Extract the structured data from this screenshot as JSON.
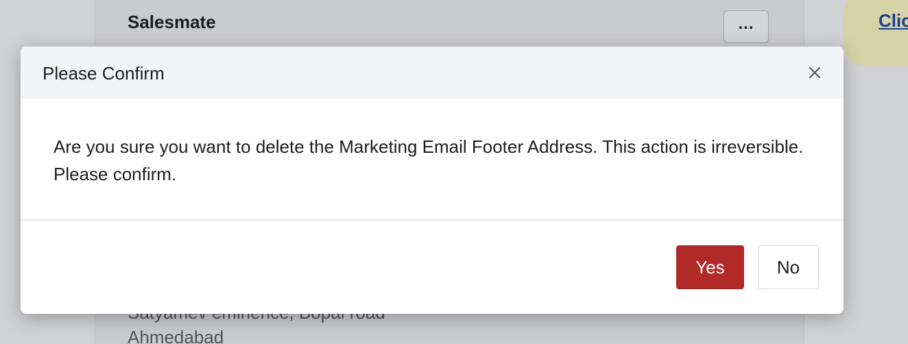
{
  "background": {
    "card_title": "Salesmate",
    "more_label": "...",
    "link_text": "Clic",
    "address_lines": [
      "Satyamev eminence, Bopal road",
      "Ahmedabad"
    ]
  },
  "modal": {
    "title": "Please Confirm",
    "close_symbol": "×",
    "message": "Are you sure you want to delete the Marketing Email Footer Address. This action is irreversible. Please confirm.",
    "yes_label": "Yes",
    "no_label": "No"
  },
  "colors": {
    "primary_danger": "#b22a28",
    "header_bg": "#f3f4f6",
    "link": "#1d3b8f"
  }
}
